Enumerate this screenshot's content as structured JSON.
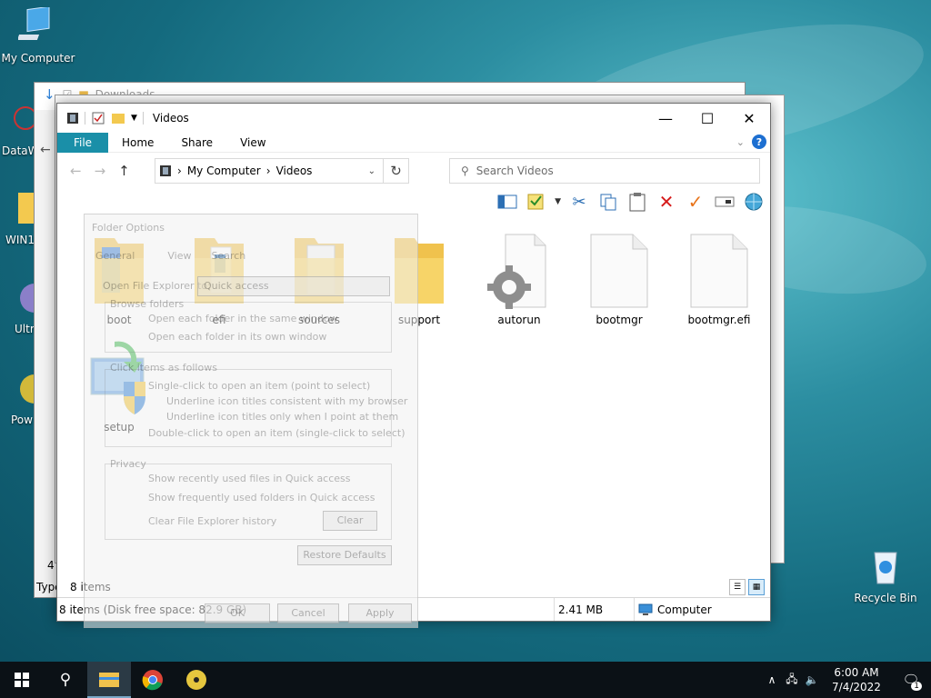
{
  "desktop": {
    "icons": [
      {
        "label": "My Computer"
      },
      {
        "label": "DataW"
      },
      {
        "label": "WIN1"
      },
      {
        "label": "Ultr"
      },
      {
        "label": "Pow"
      },
      {
        "label": "Recycle Bin"
      }
    ]
  },
  "back_window": {
    "title": "Downloads",
    "status_items": "4 i",
    "type_label": "Type"
  },
  "explorer": {
    "title": "Videos",
    "ribbon_tabs": [
      "File",
      "Home",
      "Share",
      "View"
    ],
    "address": {
      "root": "My Computer",
      "current": "Videos"
    },
    "search_placeholder": "Search Videos",
    "files": [
      {
        "name": "boot",
        "type": "folder"
      },
      {
        "name": "efi",
        "type": "folder"
      },
      {
        "name": "sources",
        "type": "folder"
      },
      {
        "name": "support",
        "type": "folder"
      },
      {
        "name": "autorun",
        "type": "settings-file"
      },
      {
        "name": "bootmgr",
        "type": "file"
      },
      {
        "name": "bootmgr.efi",
        "type": "file"
      },
      {
        "name": "setup",
        "type": "setup-exe"
      }
    ],
    "item_count": "8 items",
    "status": {
      "left": "8 items (Disk free space: 82.9 GB)",
      "size": "2.41 MB",
      "location": "Computer"
    }
  },
  "folder_options": {
    "title": "Folder Options",
    "tabs": [
      "General",
      "View",
      "Search"
    ],
    "open_in_label": "Open File Explorer to:",
    "open_in_value": "Quick access",
    "browse_group": "Browse folders",
    "browse_same": "Open each folder in the same window",
    "browse_own": "Open each folder in its own window",
    "click_group": "Click items as follows",
    "single_click": "Single-click to open an item (point to select)",
    "underline_consistent": "Underline icon titles consistent with my browser",
    "underline_point": "Underline icon titles only when I point at them",
    "double_click": "Double-click to open an item (single-click to select)",
    "privacy_group": "Privacy",
    "show_recent": "Show recently used files in Quick access",
    "show_frequent": "Show frequently used folders in Quick access",
    "clear_history": "Clear File Explorer history",
    "clear_btn": "Clear",
    "restore_btn": "Restore Defaults",
    "ok_btn": "OK",
    "cancel_btn": "Cancel",
    "apply_btn": "Apply"
  },
  "taskbar": {
    "time": "6:00 AM",
    "date": "7/4/2022",
    "notification_count": "1"
  }
}
